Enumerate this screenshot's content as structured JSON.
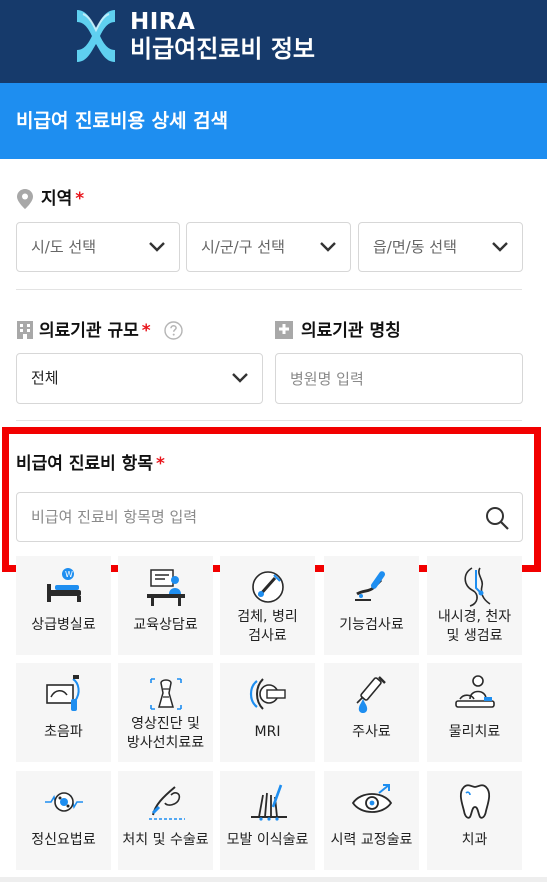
{
  "header": {
    "brand_line1": "HIRA",
    "brand_line2": "비급여진료비 정보",
    "page_title": "비급여 진료비용 상세 검색"
  },
  "region": {
    "label": "지역",
    "required_mark": "*",
    "sido": "시/도 선택",
    "sigungu": "시/군/구 선택",
    "eupmyeondong": "읍/면/동 선택"
  },
  "institution_scale": {
    "label": "의료기관 규모",
    "required_mark": "*",
    "value": "전체"
  },
  "institution_name": {
    "label": "의료기관 명칭",
    "placeholder": "병원명 입력"
  },
  "item": {
    "label": "비급여 진료비 항목",
    "required_mark": "*",
    "placeholder": "비급여 진료비 항목명 입력"
  },
  "categories": [
    {
      "label": "상급병실료",
      "icon": "hospital-bed-icon"
    },
    {
      "label": "교육상담료",
      "icon": "counseling-icon"
    },
    {
      "label": "검체, 병리\n검사료",
      "icon": "specimen-icon"
    },
    {
      "label": "기능검사료",
      "icon": "function-test-icon"
    },
    {
      "label": "내시경, 천자\n및 생검료",
      "icon": "endoscope-icon"
    },
    {
      "label": "초음파",
      "icon": "ultrasound-icon"
    },
    {
      "label": "영상진단 및\n방사선치료료",
      "icon": "radiology-icon"
    },
    {
      "label": "MRI",
      "icon": "mri-icon"
    },
    {
      "label": "주사료",
      "icon": "syringe-icon"
    },
    {
      "label": "물리치료",
      "icon": "physical-therapy-icon"
    },
    {
      "label": "정신요법료",
      "icon": "brain-wave-icon"
    },
    {
      "label": "처치 및 수술료",
      "icon": "surgery-icon"
    },
    {
      "label": "모발 이식술료",
      "icon": "hair-transplant-icon"
    },
    {
      "label": "시력 교정술료",
      "icon": "eye-icon"
    },
    {
      "label": "치과",
      "icon": "tooth-icon"
    }
  ],
  "colors": {
    "header_bg": "#163a6b",
    "title_bar_bg": "#1e8ef0",
    "required": "#e8141b",
    "highlight_border": "#f20000",
    "tile_bg": "#f6f6f6",
    "icon_accent": "#1e8ef0"
  }
}
